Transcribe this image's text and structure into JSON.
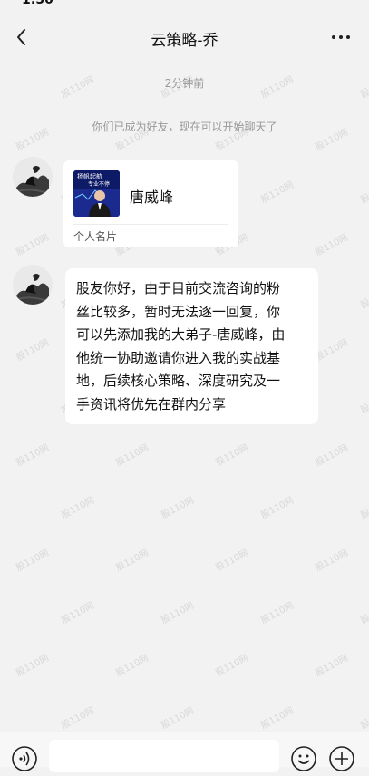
{
  "status_bar": {
    "time": "1:50"
  },
  "header": {
    "title": "云策略-乔"
  },
  "chat": {
    "timestamp": "2分钟前",
    "system_notice": "你们已成为好友，现在可以开始聊天了",
    "contact_card": {
      "thumbnail_text_line1": "扬帆起航",
      "thumbnail_text_line2": "专业不停",
      "name": "唐威峰",
      "label": "个人名片"
    },
    "message_lines": [
      "股友你好，由于目前交流咨询的粉",
      "丝比较多，暂时无法逐一回复，你",
      "可以先添加我的大弟子-唐威峰，由",
      "他统一协助邀请你进入我的实战基",
      "地，后续核心策略、深度研究及一",
      "手资讯将优先在群内分享"
    ]
  },
  "watermark": {
    "text": "股110网"
  },
  "icons": [
    "back-arrow-icon",
    "more-dots-icon",
    "voice-icon",
    "emoji-icon",
    "plus-icon"
  ],
  "colors": {
    "background": "#f2f2f2",
    "bubble": "#ffffff",
    "card_thumb": "#1b2a8f"
  }
}
